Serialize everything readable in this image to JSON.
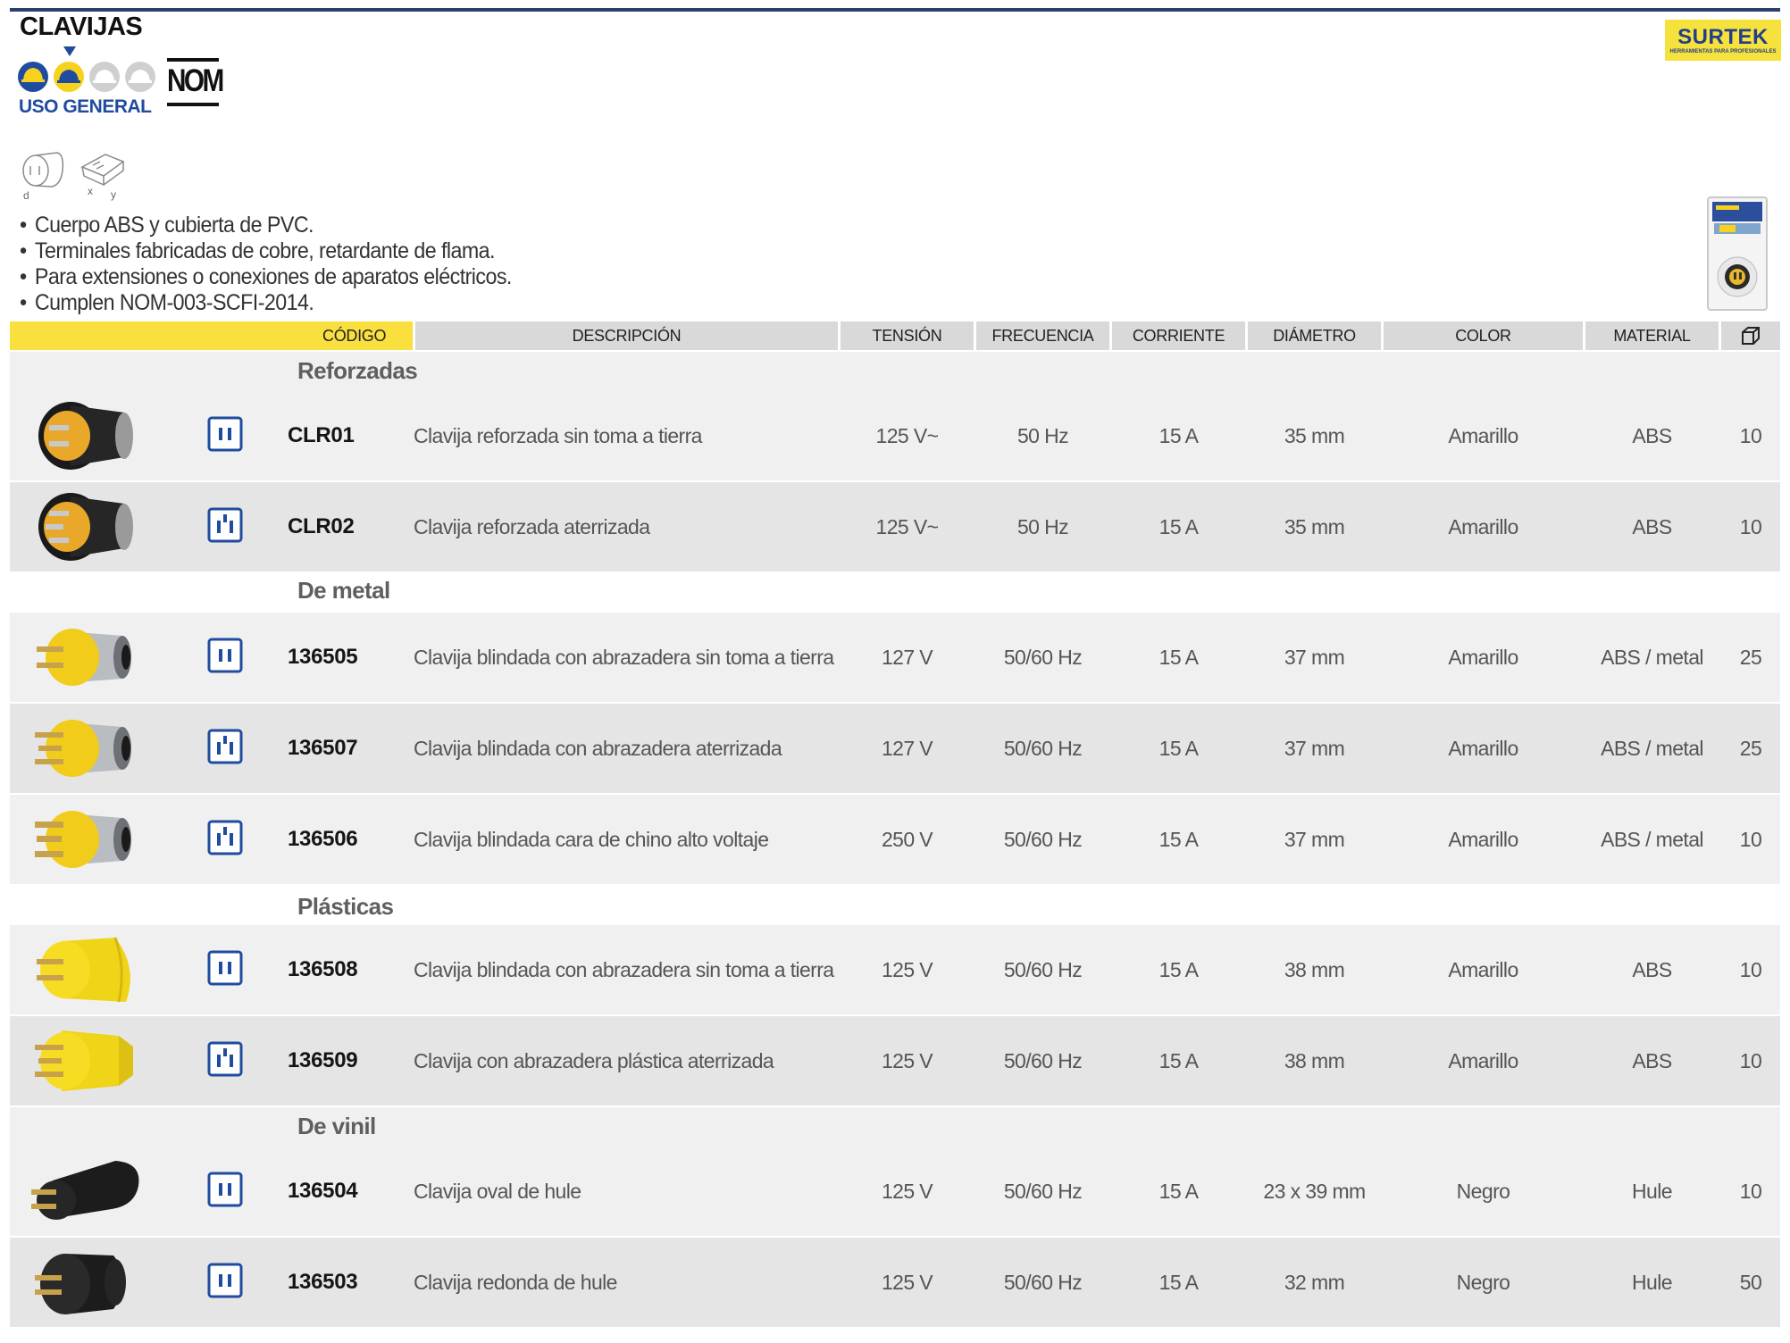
{
  "header": {
    "title": "CLAVIJAS",
    "usage_label": "USO GENERAL",
    "certification": "NOM",
    "brand": "SURTEK",
    "brand_tagline": "HERRAMIENTAS PARA PROFESIONALES",
    "dimension_labels": {
      "d": "d",
      "x": "x",
      "y": "y"
    }
  },
  "features": [
    "Cuerpo ABS y cubierta de PVC.",
    "Terminales fabricadas de cobre, retardante de flama.",
    "Para extensiones o conexiones de aparatos eléctricos.",
    "Cumplen NOM-003-SCFI-2014."
  ],
  "columns": {
    "code": "CÓDIGO",
    "description": "DESCRIPCIÓN",
    "voltage": "TENSIÓN",
    "frequency": "FRECUENCIA",
    "current": "CORRIENTE",
    "diameter": "DIÁMETRO",
    "color": "COLOR",
    "material": "MATERIAL",
    "package_icon": "box-icon"
  },
  "colors": {
    "accent_yellow": "#f9e03e",
    "brand_blue": "#1f4c9e",
    "header_gray": "#d9d9d9",
    "row_light": "#f0f0f0",
    "row_dark": "#e5e5e5"
  },
  "sections": [
    {
      "name": "Reforzadas",
      "rows": [
        {
          "code": "CLR01",
          "description": "Clavija reforzada sin toma a tierra",
          "voltage": "125 V~",
          "frequency": "50 Hz",
          "current": "15 A",
          "diameter": "35 mm",
          "color": "Amarillo",
          "material": "ABS",
          "pack": "10",
          "plug_color": "black-yellow",
          "pins": "two-prong"
        },
        {
          "code": "CLR02",
          "description": "Clavija reforzada aterrizada",
          "voltage": "125 V~",
          "frequency": "50 Hz",
          "current": "15 A",
          "diameter": "35 mm",
          "color": "Amarillo",
          "material": "ABS",
          "pack": "10",
          "plug_color": "black-yellow",
          "pins": "grounded"
        }
      ]
    },
    {
      "name": "De metal",
      "rows": [
        {
          "code": "136505",
          "description": "Clavija blindada con abrazadera sin toma a tierra",
          "voltage": "127 V",
          "frequency": "50/60 Hz",
          "current": "15 A",
          "diameter": "37 mm",
          "color": "Amarillo",
          "material": "ABS / metal",
          "pack": "25",
          "plug_color": "yellow-metal",
          "pins": "two-prong"
        },
        {
          "code": "136507",
          "description": "Clavija blindada con abrazadera aterrizada",
          "voltage": "127 V",
          "frequency": "50/60 Hz",
          "current": "15 A",
          "diameter": "37 mm",
          "color": "Amarillo",
          "material": "ABS / metal",
          "pack": "25",
          "plug_color": "yellow-metal",
          "pins": "grounded"
        },
        {
          "code": "136506",
          "description": "Clavija blindada cara de chino alto voltaje",
          "voltage": "250 V",
          "frequency": "50/60 Hz",
          "current": "15 A",
          "diameter": "37 mm",
          "color": "Amarillo",
          "material": "ABS / metal",
          "pack": "10",
          "plug_color": "yellow-metal",
          "pins": "grounded"
        }
      ]
    },
    {
      "name": "Plásticas",
      "rows": [
        {
          "code": "136508",
          "description": "Clavija blindada con abrazadera sin toma a tierra",
          "voltage": "125 V",
          "frequency": "50/60 Hz",
          "current": "15 A",
          "diameter": "38 mm",
          "color": "Amarillo",
          "material": "ABS",
          "pack": "10",
          "plug_color": "yellow",
          "pins": "two-prong"
        },
        {
          "code": "136509",
          "description": "Clavija con abrazadera plástica aterrizada",
          "voltage": "125 V",
          "frequency": "50/60 Hz",
          "current": "15 A",
          "diameter": "38 mm",
          "color": "Amarillo",
          "material": "ABS",
          "pack": "10",
          "plug_color": "yellow",
          "pins": "grounded"
        }
      ]
    },
    {
      "name": "De vinil",
      "rows": [
        {
          "code": "136504",
          "description": "Clavija oval de hule",
          "voltage": "125 V",
          "frequency": "50/60 Hz",
          "current": "15 A",
          "diameter": "23 x 39 mm",
          "color": "Negro",
          "material": "Hule",
          "pack": "10",
          "plug_color": "black",
          "pins": "two-prong"
        },
        {
          "code": "136503",
          "description": "Clavija redonda de hule",
          "voltage": "125 V",
          "frequency": "50/60 Hz",
          "current": "15 A",
          "diameter": "32 mm",
          "color": "Negro",
          "material": "Hule",
          "pack": "50",
          "plug_color": "black",
          "pins": "two-prong"
        }
      ]
    }
  ]
}
